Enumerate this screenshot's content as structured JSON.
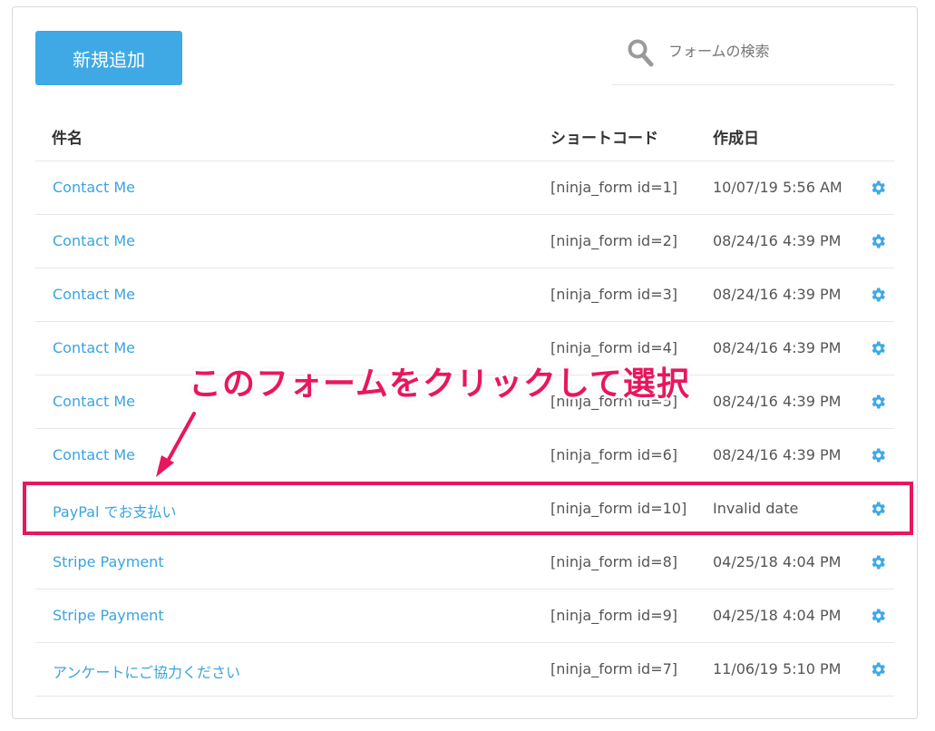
{
  "toolbar": {
    "add_label": "新規追加"
  },
  "search": {
    "placeholder": "フォームの検索",
    "value": ""
  },
  "columns": {
    "name": "件名",
    "shortcode": "ショートコード",
    "date": "作成日"
  },
  "rows": [
    {
      "name": "Contact Me",
      "shortcode": "[ninja_form id=1]",
      "date": "10/07/19 5:56 AM"
    },
    {
      "name": "Contact Me",
      "shortcode": "[ninja_form id=2]",
      "date": "08/24/16 4:39 PM"
    },
    {
      "name": "Contact Me",
      "shortcode": "[ninja_form id=3]",
      "date": "08/24/16 4:39 PM"
    },
    {
      "name": "Contact Me",
      "shortcode": "[ninja_form id=4]",
      "date": "08/24/16 4:39 PM"
    },
    {
      "name": "Contact Me",
      "shortcode": "[ninja_form id=5]",
      "date": "08/24/16 4:39 PM"
    },
    {
      "name": "Contact Me",
      "shortcode": "[ninja_form id=6]",
      "date": "08/24/16 4:39 PM"
    },
    {
      "name": "PayPal でお支払い",
      "shortcode": "[ninja_form id=10]",
      "date": "Invalid date"
    },
    {
      "name": "Stripe Payment",
      "shortcode": "[ninja_form id=8]",
      "date": "04/25/18 4:04 PM"
    },
    {
      "name": "Stripe Payment",
      "shortcode": "[ninja_form id=9]",
      "date": "04/25/18 4:04 PM"
    },
    {
      "name": "アンケートにご協力ください",
      "shortcode": "[ninja_form id=7]",
      "date": "11/06/19 5:10 PM"
    }
  ],
  "annotation": {
    "text": "このフォームをクリックして選択"
  },
  "colors": {
    "accent": "#3fa9e6",
    "link": "#3aa4e0",
    "highlight": "#e8175d"
  },
  "icons": {
    "search": "search-icon",
    "row_action": "gear-icon"
  }
}
